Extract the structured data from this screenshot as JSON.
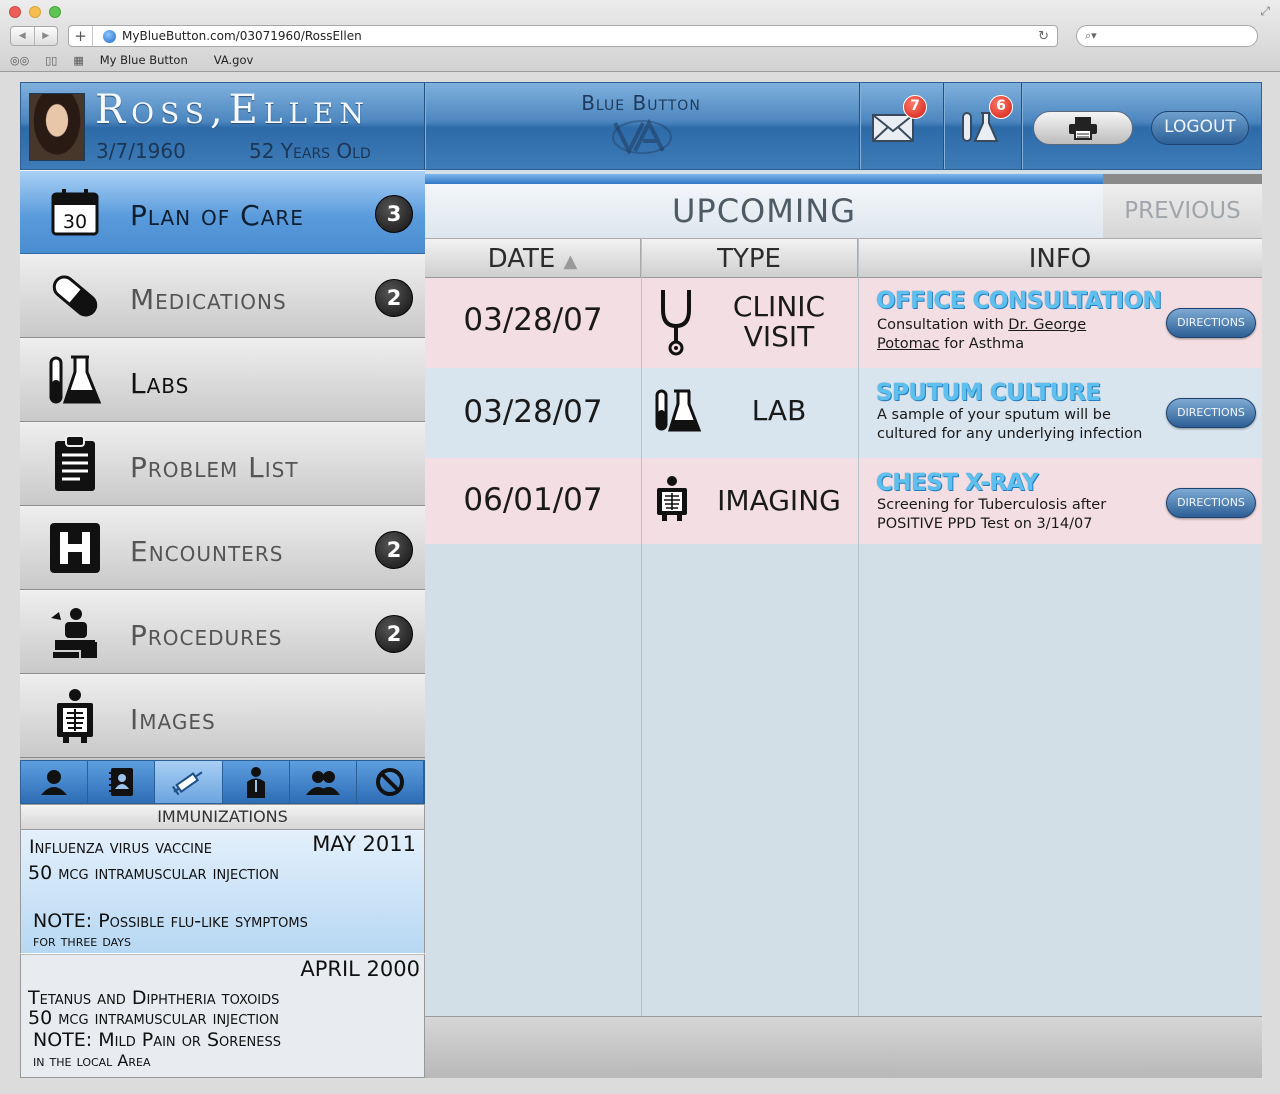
{
  "browser": {
    "url": "MyBlueButton.com/03071960/RossEllen",
    "bookmarks": [
      "My Blue Button",
      "VA.gov"
    ]
  },
  "header": {
    "patient_name": "Ross,Ellen",
    "dob": "3/7/1960",
    "age": "52 Years Old",
    "brand": "Blue Button",
    "messages_count": "7",
    "labs_count": "6",
    "logout_label": "LOGOUT"
  },
  "nav": [
    {
      "label": "Plan of Care",
      "badge": "3",
      "icon": "calendar-icon",
      "calendar_day": "30"
    },
    {
      "label": "Medications",
      "badge": "2",
      "icon": "pill-icon"
    },
    {
      "label": "Labs",
      "badge": "",
      "icon": "lab-flask-icon"
    },
    {
      "label": "Problem List",
      "badge": "",
      "icon": "clipboard-icon"
    },
    {
      "label": "Encounters",
      "badge": "2",
      "icon": "hospital-icon"
    },
    {
      "label": "Procedures",
      "badge": "2",
      "icon": "procedure-icon"
    },
    {
      "label": "Images",
      "badge": "",
      "icon": "xray-icon"
    }
  ],
  "sub_tabs": [
    "person-icon",
    "contacts-icon",
    "syringe-icon",
    "doctor-icon",
    "family-icon",
    "no-allergy-icon"
  ],
  "immunizations": {
    "title": "IMMUNIZATIONS",
    "items": [
      {
        "date": "MAY 2011",
        "name": "Influenza virus vaccine",
        "dose": "50 mcg intramuscular injection",
        "note": "NOTE: Possible flu-like symptoms",
        "note2": "for three days"
      },
      {
        "date": "APRIL 2000",
        "name": "Tetanus and Diphtheria toxoids",
        "dose": "50 mcg intramuscular injection",
        "note": "NOTE: Mild Pain or Soreness",
        "note2": "in the local Area"
      }
    ]
  },
  "main": {
    "tab_upcoming": "UPCOMING",
    "tab_previous": "PREVIOUS",
    "progress_fraction": 0.81,
    "columns": [
      "DATE",
      "TYPE",
      "INFO"
    ],
    "rows": [
      {
        "date": "03/28/07",
        "type_line1": "CLINIC",
        "type_line2": "VISIT",
        "icon": "stethoscope-icon",
        "title": "OFFICE CONSULTATION",
        "desc_pre": "Consultation with ",
        "desc_link": "Dr. George Potomac",
        "desc_post": " for Asthma",
        "button": "DIRECTIONS"
      },
      {
        "date": "03/28/07",
        "type_line1": "LAB",
        "type_line2": "",
        "icon": "lab-flask-icon",
        "title": "SPUTUM CULTURE",
        "desc": "A sample of your sputum will be cultured for any underlying infection",
        "button": "DIRECTIONS"
      },
      {
        "date": "06/01/07",
        "type_line1": "IMAGING",
        "type_line2": "",
        "icon": "xray-icon",
        "title": "CHEST X-RAY",
        "desc": "Screening for Tuberculosis after POSITIVE PPD Test on 3/14/07",
        "button": "DIRECTIONS"
      }
    ]
  }
}
